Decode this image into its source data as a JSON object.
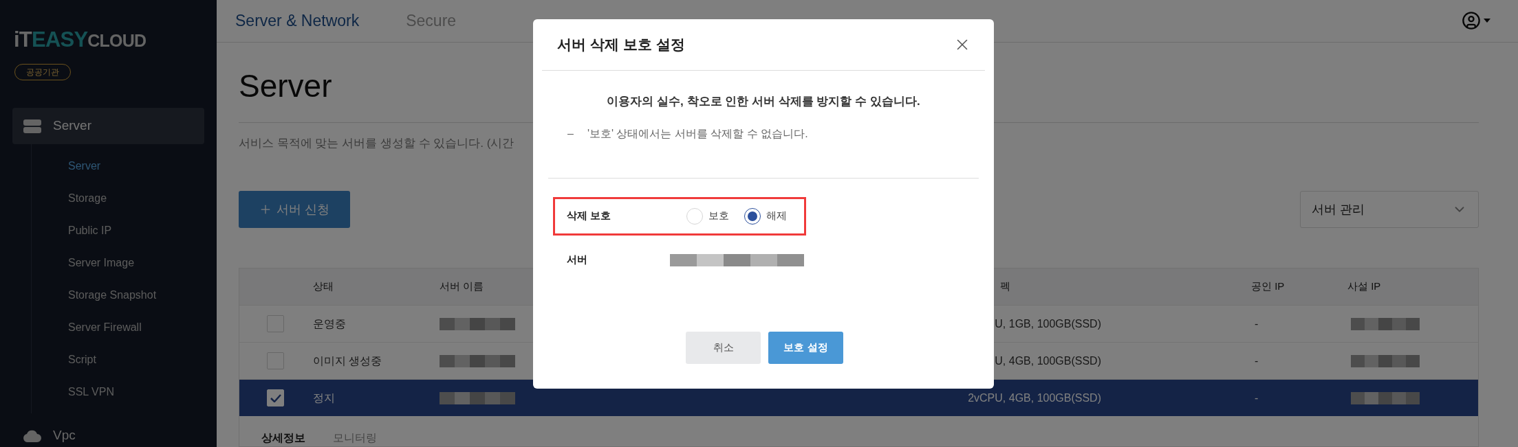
{
  "sidebar": {
    "logo": {
      "part_1": "iT",
      "part_2": "EASY",
      "part_3": "CLOUD"
    },
    "badge": "공공기관",
    "menu": [
      {
        "label": "Server",
        "kind": "server",
        "selected": true,
        "expanded": true,
        "children": [
          {
            "label": "Server",
            "selected": true
          },
          {
            "label": "Storage",
            "selected": false
          },
          {
            "label": "Public IP",
            "selected": false
          },
          {
            "label": "Server Image",
            "selected": false
          },
          {
            "label": "Storage Snapshot",
            "selected": false
          },
          {
            "label": "Server Firewall",
            "selected": false
          },
          {
            "label": "Script",
            "selected": false
          },
          {
            "label": "SSL VPN",
            "selected": false
          }
        ]
      },
      {
        "label": "Vpc",
        "kind": "cloud",
        "selected": false,
        "expanded": false
      }
    ]
  },
  "header": {
    "tabs": [
      {
        "label": "Server & Network",
        "selected": true
      },
      {
        "label": "Secure",
        "selected": false
      }
    ]
  },
  "page": {
    "title": "Server",
    "description": "서비스 목적에 맞는 서버를 생성할 수 있습니다. (시간",
    "create_button": "서버 신청",
    "dropdown": {
      "value": "서버 관리"
    }
  },
  "table": {
    "columns": [
      "상태",
      "서버 이름",
      "펙",
      "공인 IP",
      "사설 IP"
    ],
    "rows": [
      {
        "checked": false,
        "selected": false,
        "status": "운영중",
        "spec": "U, 1GB, 100GB(SSD)",
        "public_ip": "-"
      },
      {
        "checked": false,
        "selected": false,
        "status": "이미지 생성중",
        "spec": "U, 4GB, 100GB(SSD)",
        "public_ip": "-"
      },
      {
        "checked": true,
        "selected": true,
        "status": "정지",
        "spec": "2vCPU, 4GB, 100GB(SSD)",
        "public_ip": "-"
      }
    ]
  },
  "detail_tabs": [
    {
      "label": "상세정보",
      "selected": true
    },
    {
      "label": "모니터링",
      "selected": false
    }
  ],
  "dialog": {
    "title": "서버 삭제 보호 설정",
    "message": "이용자의 실수, 착오로 인한 서버 삭제를 방지할 수 있습니다.",
    "note": {
      "marker": "–",
      "text": "'보호' 상태에서는 서버를 삭제할 수 없습니다."
    },
    "fields": [
      {
        "kind": "radio",
        "label": "삭제 보호",
        "highlighted": true,
        "options": [
          {
            "label": "보호",
            "selected": false
          },
          {
            "label": "해제",
            "selected": true
          }
        ]
      },
      {
        "kind": "value",
        "label": "서버",
        "highlighted": false
      }
    ],
    "buttons": [
      {
        "label": "취소",
        "kind": "secondary"
      },
      {
        "label": "보호 설정",
        "kind": "primary"
      }
    ]
  }
}
